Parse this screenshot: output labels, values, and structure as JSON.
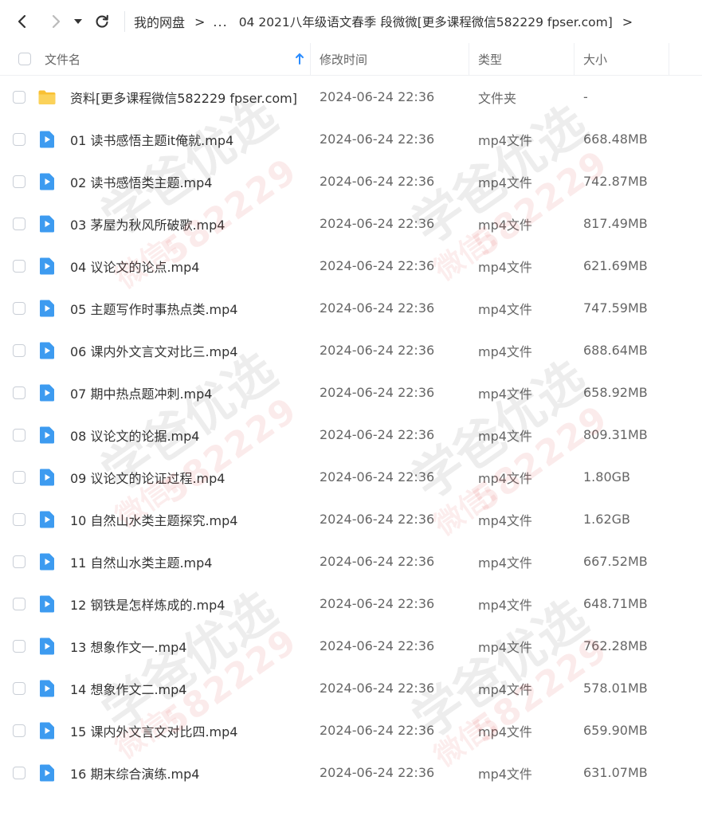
{
  "nav": {
    "back_label": "back",
    "forward_label": "forward",
    "dropdown_label": "history",
    "refresh_label": "refresh"
  },
  "breadcrumb": {
    "root": "我的网盘",
    "sep": ">",
    "ellipsis": "...",
    "current": "04 2021八年级语文春季 段微微[更多课程微信582229 fpser.com]",
    "trail": ">"
  },
  "columns": {
    "name": "文件名",
    "modified": "修改时间",
    "type": "类型",
    "size": "大小"
  },
  "files": [
    {
      "name": "资料[更多课程微信582229 fpser.com]",
      "modified": "2024-06-24 22:36",
      "type": "文件夹",
      "size": "-",
      "icon": "folder-icon"
    },
    {
      "name": "01 读书感悟主题it俺就.mp4",
      "modified": "2024-06-24 22:36",
      "type": "mp4文件",
      "size": "668.48MB",
      "icon": "video-file-icon"
    },
    {
      "name": "02 读书感悟类主题.mp4",
      "modified": "2024-06-24 22:36",
      "type": "mp4文件",
      "size": "742.87MB",
      "icon": "video-file-icon"
    },
    {
      "name": "03 茅屋为秋风所破歌.mp4",
      "modified": "2024-06-24 22:36",
      "type": "mp4文件",
      "size": "817.49MB",
      "icon": "video-file-icon"
    },
    {
      "name": "04 议论文的论点.mp4",
      "modified": "2024-06-24 22:36",
      "type": "mp4文件",
      "size": "621.69MB",
      "icon": "video-file-icon"
    },
    {
      "name": "05 主题写作时事热点类.mp4",
      "modified": "2024-06-24 22:36",
      "type": "mp4文件",
      "size": "747.59MB",
      "icon": "video-file-icon"
    },
    {
      "name": "06 课内外文言文对比三.mp4",
      "modified": "2024-06-24 22:36",
      "type": "mp4文件",
      "size": "688.64MB",
      "icon": "video-file-icon"
    },
    {
      "name": "07 期中热点题冲刺.mp4",
      "modified": "2024-06-24 22:36",
      "type": "mp4文件",
      "size": "658.92MB",
      "icon": "video-file-icon"
    },
    {
      "name": "08 议论文的论据.mp4",
      "modified": "2024-06-24 22:36",
      "type": "mp4文件",
      "size": "809.31MB",
      "icon": "video-file-icon"
    },
    {
      "name": "09 议论文的论证过程.mp4",
      "modified": "2024-06-24 22:36",
      "type": "mp4文件",
      "size": "1.80GB",
      "icon": "video-file-icon"
    },
    {
      "name": "10 自然山水类主题探究.mp4",
      "modified": "2024-06-24 22:36",
      "type": "mp4文件",
      "size": "1.62GB",
      "icon": "video-file-icon"
    },
    {
      "name": "11 自然山水类主题.mp4",
      "modified": "2024-06-24 22:36",
      "type": "mp4文件",
      "size": "667.52MB",
      "icon": "video-file-icon"
    },
    {
      "name": "12 钢铁是怎样炼成的.mp4",
      "modified": "2024-06-24 22:36",
      "type": "mp4文件",
      "size": "648.71MB",
      "icon": "video-file-icon"
    },
    {
      "name": "13 想象作文一.mp4",
      "modified": "2024-06-24 22:36",
      "type": "mp4文件",
      "size": "762.28MB",
      "icon": "video-file-icon"
    },
    {
      "name": "14 想象作文二.mp4",
      "modified": "2024-06-24 22:36",
      "type": "mp4文件",
      "size": "578.01MB",
      "icon": "video-file-icon"
    },
    {
      "name": "15 课内外文言文对比四.mp4",
      "modified": "2024-06-24 22:36",
      "type": "mp4文件",
      "size": "659.90MB",
      "icon": "video-file-icon"
    },
    {
      "name": "16 期末综合演练.mp4",
      "modified": "2024-06-24 22:36",
      "type": "mp4文件",
      "size": "631.07MB",
      "icon": "video-file-icon"
    }
  ],
  "watermark": {
    "line1": "学爸优选",
    "line2": "582229",
    "line3": "微信:"
  },
  "colors": {
    "accent": "#2a8cff",
    "folder": "#f9c033",
    "video": "#3d9bf0"
  }
}
